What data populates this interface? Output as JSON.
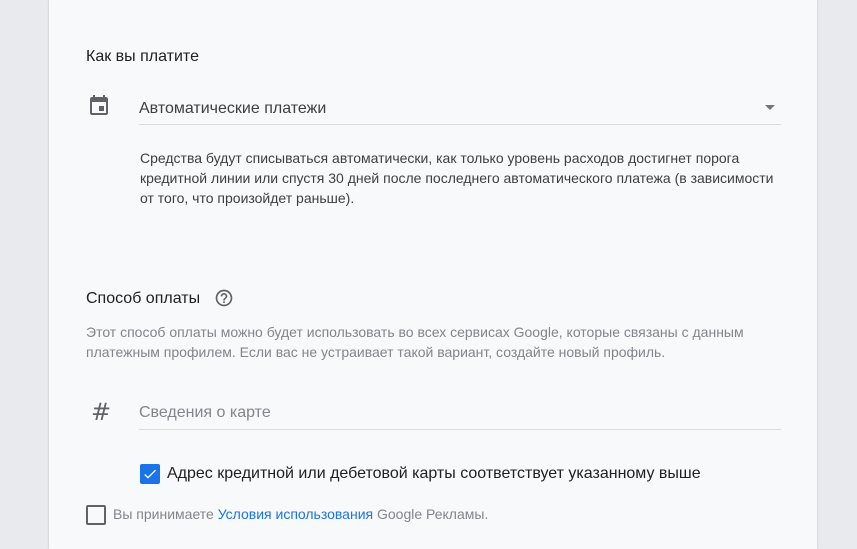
{
  "payment_schedule": {
    "title": "Как вы платите",
    "icon": "calendar-icon",
    "selected": "Автоматические платежи",
    "description": "Средства будут списываться автоматически, как только уровень расходов достигнет порога кредитной линии или спустя 30 дней после последнего автоматического платежа (в зависимости от того, что произойдет раньше)."
  },
  "payment_method": {
    "title": "Способ оплаты",
    "help_icon": "help-circle-icon",
    "info": "Этот способ оплаты можно будет использовать во всех сервисах Google, которые связаны с данным платежным профилем. Если вас не устраивает такой вариант, создайте новый профиль.",
    "card_icon": "hash-icon",
    "card_placeholder": "Сведения о карте",
    "address_checkbox": {
      "label": "Адрес кредитной или дебетовой карты соответствует указанному выше",
      "checked": true
    }
  },
  "terms": {
    "checked": false,
    "prefix": "Вы принимаете ",
    "link": "Условия использования",
    "suffix": " Google Рекламы."
  },
  "colors": {
    "accent": "#1a73e8",
    "background": "#f8f9fa"
  }
}
